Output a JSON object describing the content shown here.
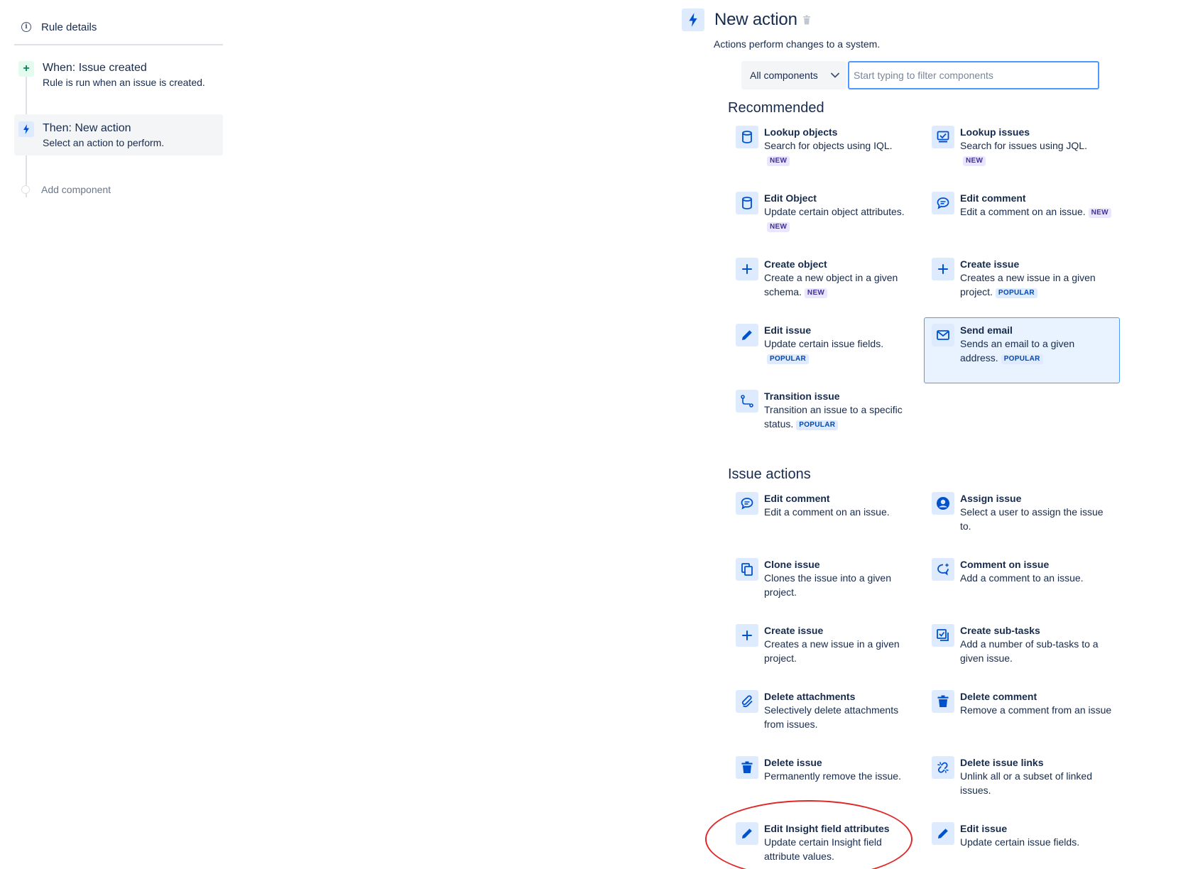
{
  "rule_panel": {
    "rule_details_label": "Rule details",
    "steps": [
      {
        "title": "When: Issue created",
        "subtitle": "Rule is run when an issue is created."
      },
      {
        "title": "Then: New action",
        "subtitle": "Select an action to perform."
      }
    ],
    "add_component_label": "Add component"
  },
  "header": {
    "title": "New action",
    "description": "Actions perform changes to a system."
  },
  "filter": {
    "select_value": "All components",
    "placeholder": "Start typing to filter components"
  },
  "recommended": {
    "title": "Recommended",
    "items": [
      {
        "icon": "database-icon",
        "title": "Lookup objects",
        "desc": "Search for objects using IQL.",
        "tag": "NEW"
      },
      {
        "icon": "lookup-issues-icon",
        "title": "Lookup issues",
        "desc": "Search for issues using JQL.",
        "tag": "NEW"
      },
      {
        "icon": "database-icon",
        "title": "Edit Object",
        "desc": "Update certain object attributes.",
        "tag": "NEW"
      },
      {
        "icon": "comment-icon",
        "title": "Edit comment",
        "desc": "Edit a comment on an issue.",
        "tag": "NEW"
      },
      {
        "icon": "plus-icon",
        "title": "Create object",
        "desc": "Create a new object in a given schema.",
        "tag": "NEW"
      },
      {
        "icon": "plus-icon",
        "title": "Create issue",
        "desc": "Creates a new issue in a given project.",
        "tag": "POPULAR"
      },
      {
        "icon": "pencil-icon",
        "title": "Edit issue",
        "desc": "Update certain issue fields.",
        "tag": "POPULAR"
      },
      {
        "icon": "email-icon",
        "title": "Send email",
        "desc": "Sends an email to a given address.",
        "tag": "POPULAR",
        "selected": true
      },
      {
        "icon": "transition-icon",
        "title": "Transition issue",
        "desc": "Transition an issue to a specific status.",
        "tag": "POPULAR"
      }
    ]
  },
  "issue_actions": {
    "title": "Issue actions",
    "items": [
      {
        "icon": "comment-icon",
        "title": "Edit comment",
        "desc": "Edit a comment on an issue."
      },
      {
        "icon": "user-avatar-icon",
        "title": "Assign issue",
        "desc": "Select a user to assign the issue to."
      },
      {
        "icon": "clone-icon",
        "title": "Clone issue",
        "desc": "Clones the issue into a given project."
      },
      {
        "icon": "comment-add-icon",
        "title": "Comment on issue",
        "desc": "Add a comment to an issue."
      },
      {
        "icon": "plus-icon",
        "title": "Create issue",
        "desc": "Creates a new issue in a given project."
      },
      {
        "icon": "subtasks-icon",
        "title": "Create sub-tasks",
        "desc": "Add a number of sub-tasks to a given issue."
      },
      {
        "icon": "attachment-icon",
        "title": "Delete attachments",
        "desc": "Selectively delete attachments from issues."
      },
      {
        "icon": "trash-icon",
        "title": "Delete comment",
        "desc": "Remove a comment from an issue"
      },
      {
        "icon": "trash-icon",
        "title": "Delete issue",
        "desc": "Permanently remove the issue."
      },
      {
        "icon": "unlink-icon",
        "title": "Delete issue links",
        "desc": "Unlink all or a subset of linked issues."
      },
      {
        "icon": "pencil-icon",
        "title": "Edit Insight field attributes",
        "desc": "Update certain Insight field attribute values."
      },
      {
        "icon": "pencil-icon",
        "title": "Edit issue",
        "desc": "Update certain issue fields."
      }
    ]
  },
  "colors": {
    "icon_blue": "#0052cc",
    "highlight_ring": "#e02828",
    "selected_card_bg": "#e9f2ff"
  }
}
